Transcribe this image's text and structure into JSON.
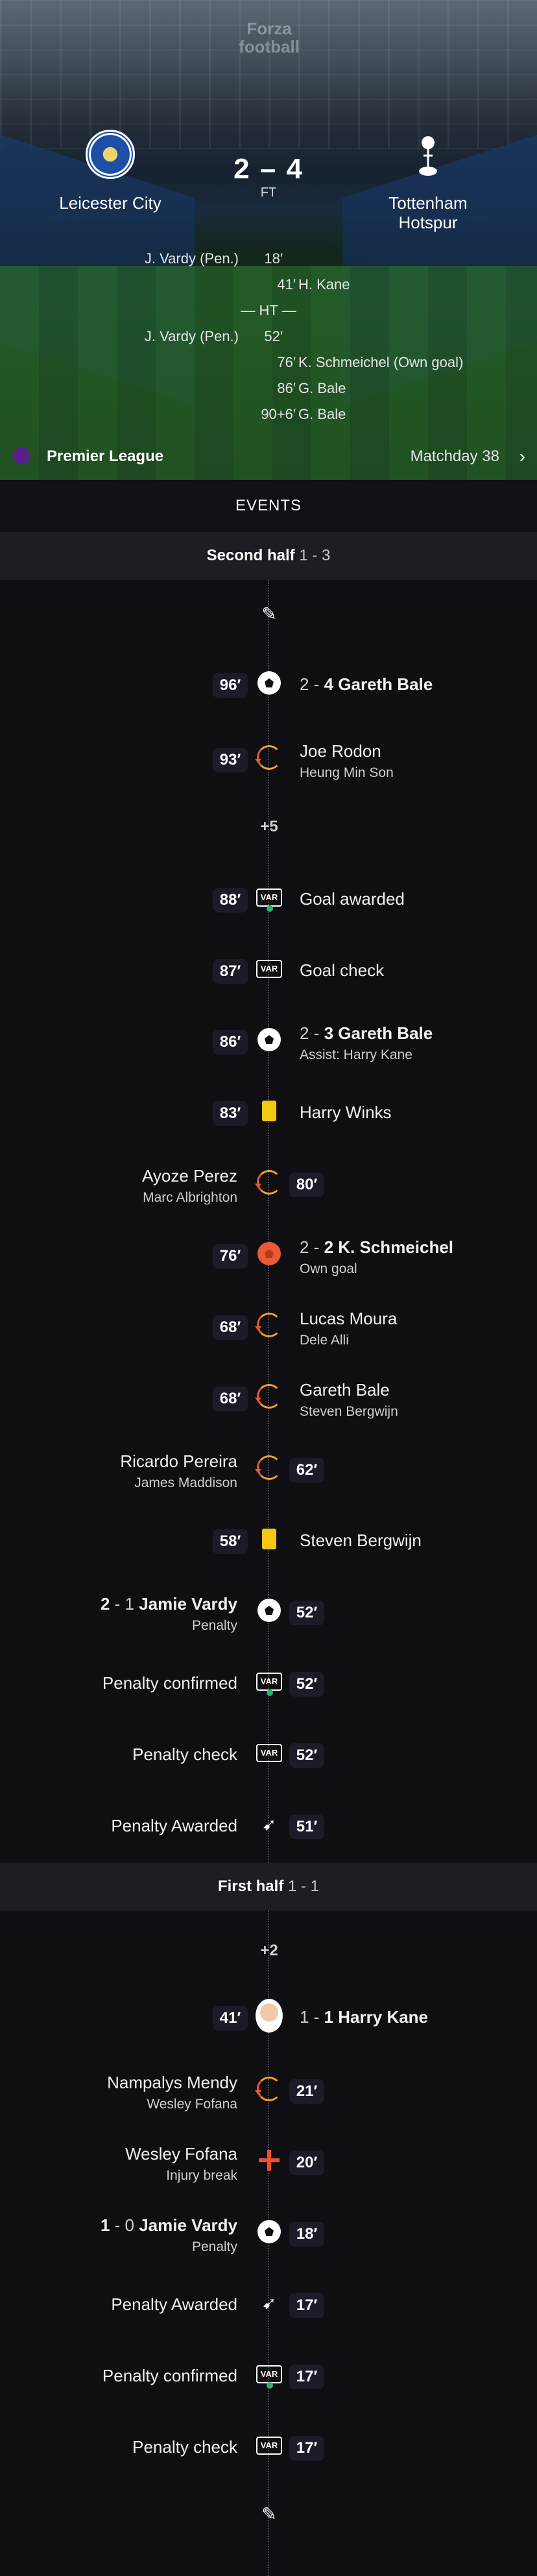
{
  "brand": "Forza football",
  "match": {
    "home": "Leicester City",
    "away": "Tottenham Hotspur",
    "score": "2 – 4",
    "status": "FT",
    "ht": "— HT —",
    "scorers": [
      {
        "side": "home",
        "name": "J. Vardy (Pen.)",
        "minute": "18′"
      },
      {
        "side": "away",
        "name": "H. Kane",
        "minute": "41′"
      },
      {
        "side": "ht"
      },
      {
        "side": "home",
        "name": "J. Vardy (Pen.)",
        "minute": "52′"
      },
      {
        "side": "away",
        "name": "K. Schmeichel (Own goal)",
        "minute": "76′"
      },
      {
        "side": "away",
        "name": "G. Bale",
        "minute": "86′"
      },
      {
        "side": "away",
        "name": "G. Bale",
        "minute": "90+6′"
      }
    ]
  },
  "league": {
    "name": "Premier League",
    "matchday": "Matchday 38"
  },
  "events_title": "EVENTS",
  "second_half": {
    "label": "Second half",
    "score": "1 - 3"
  },
  "first_half": {
    "label": "First half",
    "score": "1 - 1"
  },
  "events": [
    {
      "id": "e1",
      "type": "whistle"
    },
    {
      "id": "e2",
      "type": "goal",
      "side": "away",
      "minute": "96′",
      "score": "2 - ",
      "score2": "4",
      "main": "Gareth Bale",
      "sub": ""
    },
    {
      "id": "e3",
      "type": "substitution",
      "side": "away",
      "minute": "93′",
      "main": "Joe Rodon",
      "sub": "Heung Min Son"
    },
    {
      "id": "e4",
      "type": "added",
      "label": "+5"
    },
    {
      "id": "e5",
      "type": "var",
      "side": "away",
      "minute": "88′",
      "main": "Goal awarded",
      "dot": true
    },
    {
      "id": "e6",
      "type": "var",
      "side": "away",
      "minute": "87′",
      "main": "Goal check",
      "dot": false
    },
    {
      "id": "e7",
      "type": "goal",
      "side": "away",
      "minute": "86′",
      "score": "2 - ",
      "score2": "3",
      "main": "Gareth Bale",
      "sub": "Assist: Harry Kane"
    },
    {
      "id": "e8",
      "type": "yellow",
      "side": "away",
      "minute": "83′",
      "main": "Harry Winks"
    },
    {
      "id": "e9",
      "type": "substitution",
      "side": "home",
      "minute": "80′",
      "main": "Ayoze Perez",
      "sub": "Marc Albrighton"
    },
    {
      "id": "e10",
      "type": "owngoal",
      "side": "away",
      "minute": "76′",
      "score": "2 - ",
      "score2": "2",
      "main": "K. Schmeichel",
      "sub": "Own goal"
    },
    {
      "id": "e11",
      "type": "substitution",
      "side": "away",
      "minute": "68′",
      "main": "Lucas Moura",
      "sub": "Dele Alli"
    },
    {
      "id": "e12",
      "type": "substitution",
      "side": "away",
      "minute": "68′",
      "main": "Gareth Bale",
      "sub": "Steven Bergwijn"
    },
    {
      "id": "e13",
      "type": "substitution",
      "side": "home",
      "minute": "62′",
      "main": "Ricardo Pereira",
      "sub": "James Maddison"
    },
    {
      "id": "e14",
      "type": "yellow",
      "side": "away",
      "minute": "58′",
      "main": "Steven Bergwijn"
    },
    {
      "id": "e15",
      "type": "goal",
      "side": "home",
      "minute": "52′",
      "score": "2",
      "score2": " - 1",
      "main": "Jamie Vardy",
      "sub": "Penalty"
    },
    {
      "id": "e16",
      "type": "var",
      "side": "home",
      "minute": "52′",
      "main": "Penalty confirmed",
      "dot": true
    },
    {
      "id": "e17",
      "type": "var",
      "side": "home",
      "minute": "52′",
      "main": "Penalty check",
      "dot": false
    },
    {
      "id": "e18",
      "type": "penalty",
      "side": "home",
      "minute": "51′",
      "main": "Penalty Awarded"
    },
    {
      "id": "e19",
      "type": "added",
      "label": "+2"
    },
    {
      "id": "e20",
      "type": "kane",
      "side": "away",
      "minute": "41′",
      "score": "1 - ",
      "score2": "1",
      "main": "Harry Kane"
    },
    {
      "id": "e21",
      "type": "substitution",
      "side": "home",
      "minute": "21′",
      "main": "Nampalys Mendy",
      "sub": "Wesley Fofana"
    },
    {
      "id": "e22",
      "type": "injury",
      "side": "home",
      "minute": "20′",
      "main": "Wesley Fofana",
      "sub": "Injury break"
    },
    {
      "id": "e23",
      "type": "goal",
      "side": "home",
      "minute": "18′",
      "score": "1",
      "score2": " - 0",
      "main": "Jamie Vardy",
      "sub": "Penalty"
    },
    {
      "id": "e24",
      "type": "penalty",
      "side": "home",
      "minute": "17′",
      "main": "Penalty Awarded"
    },
    {
      "id": "e25",
      "type": "var",
      "side": "home",
      "minute": "17′",
      "main": "Penalty confirmed",
      "dot": true
    },
    {
      "id": "e26",
      "type": "var",
      "side": "home",
      "minute": "17′",
      "main": "Penalty check",
      "dot": false
    },
    {
      "id": "e27",
      "type": "whistle"
    }
  ],
  "colors": {
    "background": "#0e0e13",
    "half_bar": "#1d1d24",
    "pill": "#1c1c28",
    "yellow_card": "#f2c813",
    "sub_arrow": "#f0a12a",
    "var_dot": "#2db36a",
    "injury": "#f0512a"
  }
}
